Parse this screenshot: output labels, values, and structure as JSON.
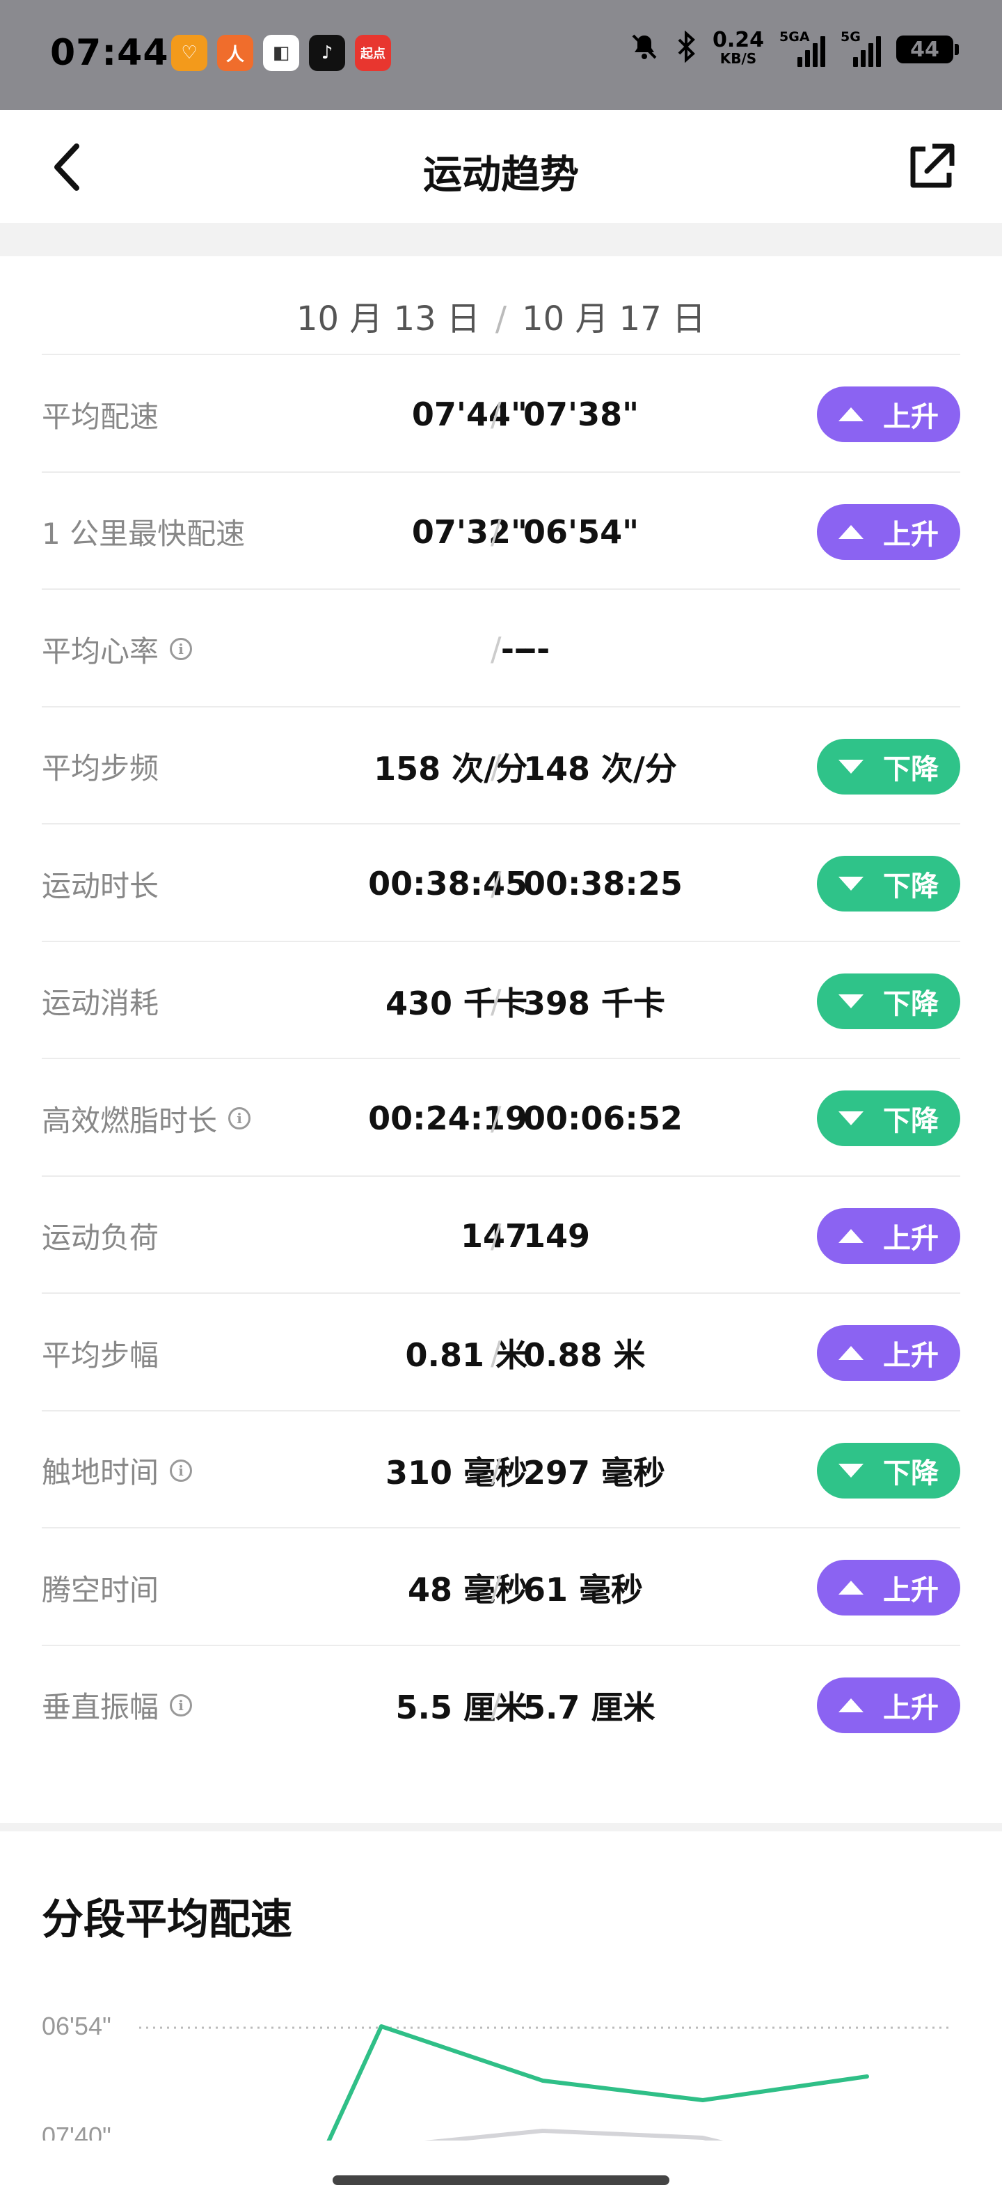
{
  "status_bar": {
    "time": "07:44",
    "apps": [
      {
        "icon": "app-orange-heart-icon",
        "glyph": "♡",
        "color": "#f39a1b"
      },
      {
        "icon": "app-orange-figure-icon",
        "glyph": "人",
        "color": "#f06d2c"
      },
      {
        "icon": "app-white-square-icon",
        "glyph": "◧",
        "color": "#ffffff"
      },
      {
        "icon": "tiktok-icon",
        "glyph": "♪",
        "color": "#111111"
      },
      {
        "icon": "qidian-icon",
        "glyph": "起点",
        "color": "#e8362f"
      }
    ],
    "speed_value": "0.24",
    "speed_unit": "KB/S",
    "sig1_label": "5GA",
    "sig2_label": "5G",
    "battery": "44"
  },
  "header": {
    "title": "运动趋势"
  },
  "compare": {
    "date_left": "10 月 13 日",
    "date_right": "10 月 17 日",
    "sep": "/",
    "rows": [
      {
        "label": "平均配速",
        "info": false,
        "left": "07'44\"",
        "right": "07'38\"",
        "trend": "上升",
        "dir": "up"
      },
      {
        "label": "1 公里最快配速",
        "info": false,
        "left": "07'32\"",
        "right": "06'54\"",
        "trend": "上升",
        "dir": "up"
      },
      {
        "label": "平均心率",
        "info": true,
        "left": "--",
        "right": "--",
        "trend": "",
        "dir": "none"
      },
      {
        "label": "平均步频",
        "info": false,
        "left": "158 次/分",
        "right": "148 次/分",
        "trend": "下降",
        "dir": "down"
      },
      {
        "label": "运动时长",
        "info": false,
        "left": "00:38:45",
        "right": "00:38:25",
        "trend": "下降",
        "dir": "down"
      },
      {
        "label": "运动消耗",
        "info": false,
        "left": "430 千卡",
        "right": "398 千卡",
        "trend": "下降",
        "dir": "down"
      },
      {
        "label": "高效燃脂时长",
        "info": true,
        "left": "00:24:19",
        "right": "00:06:52",
        "trend": "下降",
        "dir": "down"
      },
      {
        "label": "运动负荷",
        "info": false,
        "left": "147",
        "right": "149",
        "trend": "上升",
        "dir": "up"
      },
      {
        "label": "平均步幅",
        "info": false,
        "left": "0.81 米",
        "right": "0.88 米",
        "trend": "上升",
        "dir": "up"
      },
      {
        "label": "触地时间",
        "info": true,
        "left": "310 毫秒",
        "right": "297 毫秒",
        "trend": "下降",
        "dir": "down"
      },
      {
        "label": "腾空时间",
        "info": false,
        "left": "48 毫秒",
        "right": "61 毫秒",
        "trend": "上升",
        "dir": "up"
      },
      {
        "label": "垂直振幅",
        "info": true,
        "left": "5.5 厘米",
        "right": "5.7 厘米",
        "trend": "上升",
        "dir": "up"
      }
    ]
  },
  "segment_chart": {
    "title": "分段平均配速",
    "y_tick_top": "06'54\"",
    "y_tick_bottom": "07'40\"",
    "colors": {
      "green": "#2fbf87",
      "gray": "#d4d4d8"
    }
  }
}
